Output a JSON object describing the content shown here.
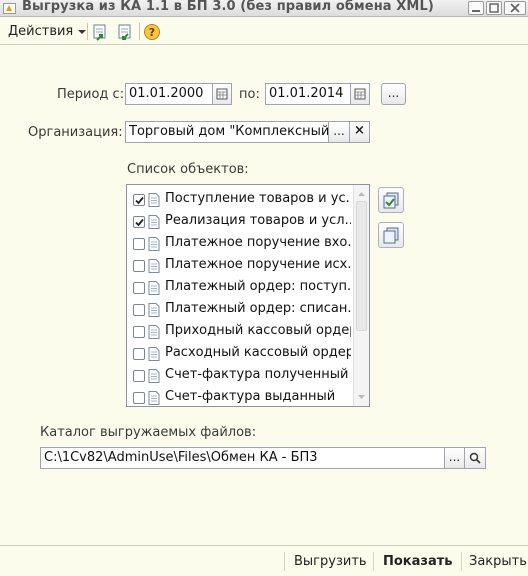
{
  "window": {
    "title": "Выгрузка из КА 1.1 в БП 3.0 (без правил обмена XML)"
  },
  "toolbar": {
    "actions_label": "Действия"
  },
  "period": {
    "from_label": "Период с:",
    "from_value": "01.01.2000",
    "to_label": "по:",
    "to_value": "01.01.2014",
    "more_label": "..."
  },
  "organization": {
    "label": "Организация:",
    "value": "Торговый дом \"Комплексный\"",
    "select_label": "...",
    "clear_label": "×"
  },
  "objects": {
    "label": "Список объектов:",
    "items": [
      {
        "label": "Поступление товаров и ус...",
        "checked": true
      },
      {
        "label": "Реализация товаров и усл...",
        "checked": true
      },
      {
        "label": "Платежное поручение вхо...",
        "checked": false
      },
      {
        "label": "Платежное поручение исх...",
        "checked": false
      },
      {
        "label": "Платежный ордер: поступ...",
        "checked": false
      },
      {
        "label": "Платежный ордер: списан...",
        "checked": false
      },
      {
        "label": "Приходный кассовый ордер",
        "checked": false
      },
      {
        "label": "Расходный кассовый ордер",
        "checked": false
      },
      {
        "label": "Счет-фактура полученный",
        "checked": false
      },
      {
        "label": "Счет-фактура выданный",
        "checked": false
      }
    ]
  },
  "catalog": {
    "label": "Каталог выгружаемых файлов:",
    "value": "C:\\1Cv82\\AdminUse\\Files\\Обмен КА - БП3",
    "browse_label": "..."
  },
  "footer": {
    "export_label": "Выгрузить",
    "show_label": "Показать",
    "close_label": "Закрыть"
  },
  "colors": {
    "background": "#fbfcec",
    "accent": "#2f7d32"
  }
}
